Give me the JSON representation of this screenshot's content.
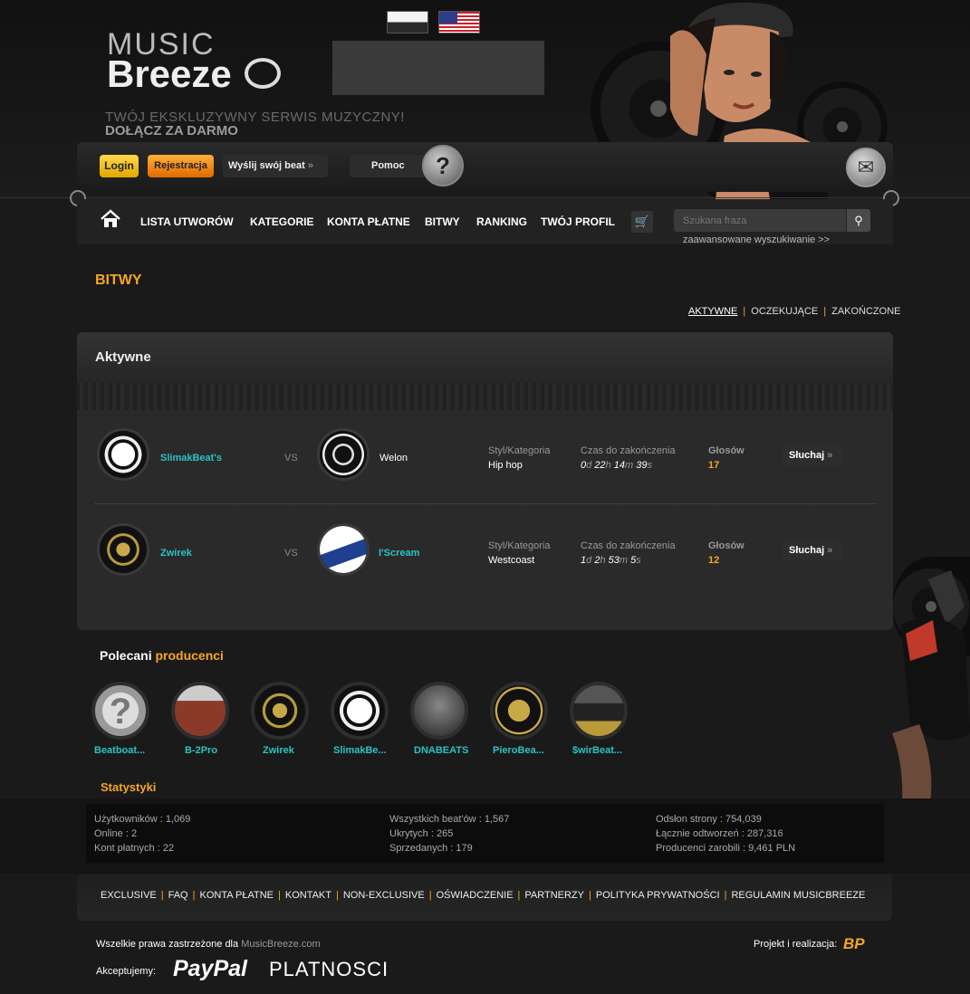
{
  "header": {
    "logo_top": "MUSIC",
    "logo_bottom": "Breeze",
    "tagline_1": "TWÓJ EKSKLUZYWNY SERWIS MUZYCZNY!",
    "tagline_2": "DOŁĄCZ ZA DARMO",
    "languages": [
      "pl-flag",
      "us-flag"
    ]
  },
  "toolbar": {
    "login": "Login",
    "register": "Rejestracja",
    "send_beat": "Wyślij swój beat",
    "help": "Pomoc",
    "help_glyph": "?",
    "chevron": "»"
  },
  "nav": {
    "items": [
      "LISTA UTWORÓW",
      "KATEGORIE",
      "KONTA PŁATNE",
      "BITWY",
      "RANKING",
      "TWÓJ PROFIL"
    ],
    "search_placeholder": "Szukana fraza",
    "advanced_search": "zaawansowane wyszukiwanie >>"
  },
  "page": {
    "title": "BITWY",
    "filters": [
      "AKTYWNE",
      "OCZEKUJĄCE",
      "ZAKOŃCZONE"
    ],
    "panel_title": "Aktywne"
  },
  "battles": [
    {
      "player1": "SlimakBeat's",
      "player2": "Welon",
      "vs": "VS",
      "style_label": "Styl/Kategoria",
      "style": "Hip hop",
      "time_label": "Czas do zakończenia",
      "d": "0",
      "h": "22",
      "m": "14",
      "s": "39",
      "votes_label": "Głosów",
      "votes": "17",
      "listen": "Słuchaj"
    },
    {
      "player1": "Zwirek",
      "player2": "I'Scream",
      "vs": "VS",
      "style_label": "Styl/Kategoria",
      "style": "Westcoast",
      "time_label": "Czas do zakończenia",
      "d": "1",
      "h": "2",
      "m": "53",
      "s": "5",
      "votes_label": "Głosów",
      "votes": "12",
      "listen": "Słuchaj"
    }
  ],
  "time_units": {
    "d": "d",
    "h": "h",
    "m": "m",
    "s": "s"
  },
  "recommended": {
    "title_white": "Polecani",
    "title_orange": "producenci",
    "producers": [
      "Beatboat...",
      "B-2Pro",
      "Zwirek",
      "SlimakBe...",
      "DNABEATS",
      "PieroBea...",
      "$wirBeat..."
    ]
  },
  "stats": {
    "title_orange": "Stat",
    "title_white": "ystyki",
    "col1": [
      {
        "label": "Użytkowników",
        "value": "1,069"
      },
      {
        "label": "Online",
        "value": "2"
      },
      {
        "label": "Kont płatnych",
        "value": "22"
      }
    ],
    "col2": [
      {
        "label": "Wszystkich beat'ów",
        "value": "1,567"
      },
      {
        "label": "Ukrytych",
        "value": "265"
      },
      {
        "label": "Sprzedanych",
        "value": "179"
      }
    ],
    "col3": [
      {
        "label": "Odsłon strony",
        "value": "754,039"
      },
      {
        "label": "Łącznie odtworzeń",
        "value": "287,316"
      },
      {
        "label": "Producenci zarobili",
        "value": "9,461 PLN"
      }
    ]
  },
  "footer": {
    "links": [
      "EXCLUSIVE",
      "FAQ",
      "KONTA PŁATNE",
      "KONTAKT",
      "NON-EXCLUSIVE",
      "OŚWIADCZENIE",
      "PARTNERZY",
      "POLITYKA PRYWATNOŚCI",
      "REGULAMIN MUSICBREEZE"
    ],
    "copyright": "Wszelkie prawa zastrzeżone dla",
    "site": "MusicBreeze.com",
    "project": "Projekt i realizacja:",
    "project_logo": "BP",
    "accept": "Akceptujemy:",
    "paypal": "PayPal",
    "platnosci": "PLATNOSCI"
  },
  "colors": {
    "accent": "#f5a623",
    "link": "#2bc3c3",
    "background": "#1a1a1a"
  }
}
